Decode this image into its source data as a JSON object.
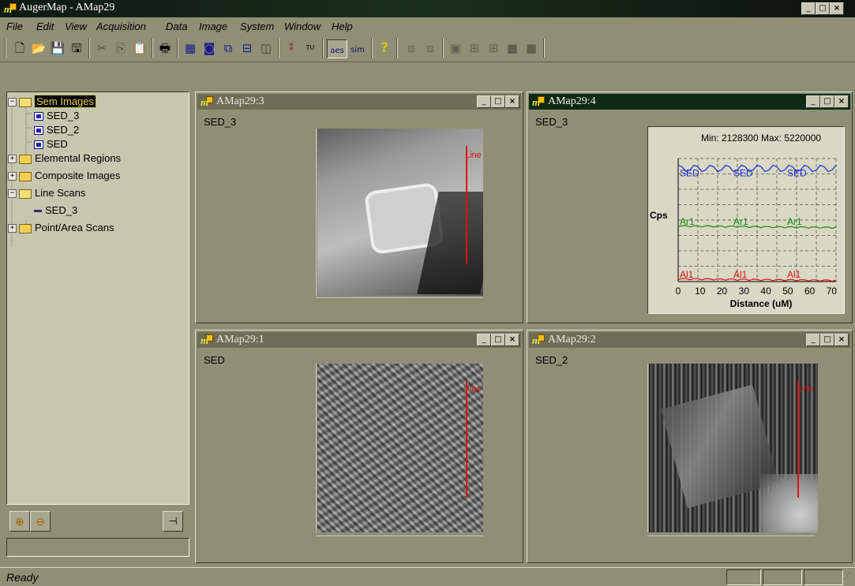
{
  "app": {
    "title": "AugerMap - AMap29"
  },
  "window_controls": {
    "minimize": "_",
    "maximize": "□",
    "close": "×"
  },
  "menu": [
    "File",
    "Edit",
    "View",
    "Acquisition",
    "Data",
    "Image",
    "System",
    "Window",
    "Help"
  ],
  "toolbar": {
    "buttons": [
      "new",
      "open",
      "save",
      "save-as",
      "cut",
      "copy",
      "paste",
      "print",
      "grid",
      "point",
      "region",
      "line",
      "frame",
      "scan",
      "tu",
      "aes",
      "sim",
      "help",
      "b1",
      "b2",
      "b3",
      "b4",
      "b5",
      "b6",
      "b7"
    ],
    "aes_label": "aes",
    "sim_label": "sim",
    "tu_label": "TU",
    "help_label": "?"
  },
  "tree": {
    "items": [
      {
        "label": "Sem Images",
        "level": 0,
        "expander": "−",
        "icon": "folder-open-icon"
      },
      {
        "label": "SED_3",
        "level": 1,
        "icon": "image-icon"
      },
      {
        "label": "SED_2",
        "level": 1,
        "icon": "image-icon"
      },
      {
        "label": "SED",
        "level": 1,
        "icon": "image-icon"
      },
      {
        "label": "Elemental Regions",
        "level": 0,
        "expander": "+",
        "icon": "folder-icon"
      },
      {
        "label": "Composite Images",
        "level": 0,
        "expander": "+",
        "icon": "folder-icon"
      },
      {
        "label": "Line Scans",
        "level": 0,
        "expander": "−",
        "icon": "folder-open-icon"
      },
      {
        "label": "SED_3",
        "level": 1,
        "icon": "line-scan-icon"
      },
      {
        "label": "Point/Area Scans",
        "level": 0,
        "expander": "+",
        "icon": "folder-icon"
      }
    ]
  },
  "windows": {
    "w3": {
      "title": "AMap29:3",
      "image_label": "SED_3",
      "line_label": "Line"
    },
    "w4": {
      "title": "AMap29:4",
      "image_label": "SED_3"
    },
    "w1": {
      "title": "AMap29:1",
      "image_label": "SED",
      "line_label": "Line"
    },
    "w2": {
      "title": "AMap29:2",
      "image_label": "SED_2",
      "line_label": "Line"
    }
  },
  "chart_data": {
    "type": "line",
    "title": "Min: 2128300  Max: 5220000",
    "xlabel": "Distance (uM)",
    "ylabel": "Cps",
    "xticks": [
      "0",
      "10",
      "20",
      "30",
      "40",
      "50",
      "60",
      "70"
    ],
    "xlim": [
      0,
      72
    ],
    "grid": true,
    "series": [
      {
        "name": "SED",
        "color": "#1a2ad8",
        "labels": [
          "SED",
          "SED",
          "SED"
        ],
        "y_level": 0.92
      },
      {
        "name": "Ar1",
        "color": "#1a8a1a",
        "labels": [
          "Ar1",
          "Ar1",
          "Ar1"
        ],
        "y_level": 0.45
      },
      {
        "name": "Al1",
        "color": "#e01010",
        "labels": [
          "Al1",
          "Al1",
          "Al1"
        ],
        "y_level": 0.02
      }
    ]
  },
  "statusbar": {
    "text": "Ready"
  }
}
